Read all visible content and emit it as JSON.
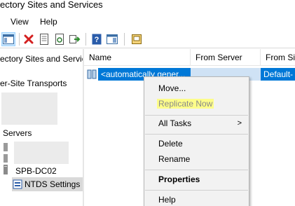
{
  "window": {
    "title": "ectory Sites and Services"
  },
  "menu": {
    "view": "View",
    "help": "Help"
  },
  "toolbar": {
    "icons": [
      "console-tree-icon",
      "delete-icon",
      "properties-icon",
      "refresh-icon",
      "export-icon",
      "help-icon",
      "show-hide-icon",
      "connect-icon"
    ]
  },
  "tree": {
    "root": "ectory Sites and Servic",
    "transports": "er-Site Transports",
    "servers": "Servers",
    "server_name": "SPB-DC02",
    "ntds": "NTDS Settings"
  },
  "list": {
    "columns": [
      "Name",
      "From Server",
      "From Sit"
    ],
    "rows": [
      {
        "name": "<automatically gener...",
        "from_server": "",
        "from_site": "Default-"
      }
    ]
  },
  "context_menu": {
    "move": "Move...",
    "replicate_now": "Replicate Now",
    "all_tasks": "All Tasks",
    "submenu_arrow": ">",
    "delete": "Delete",
    "rename": "Rename",
    "properties": "Properties",
    "help": "Help"
  },
  "colors": {
    "selection_blue": "#0078d7",
    "highlight_yellow": "#fdfd8a",
    "toolbar_active": "#cce8ff"
  }
}
